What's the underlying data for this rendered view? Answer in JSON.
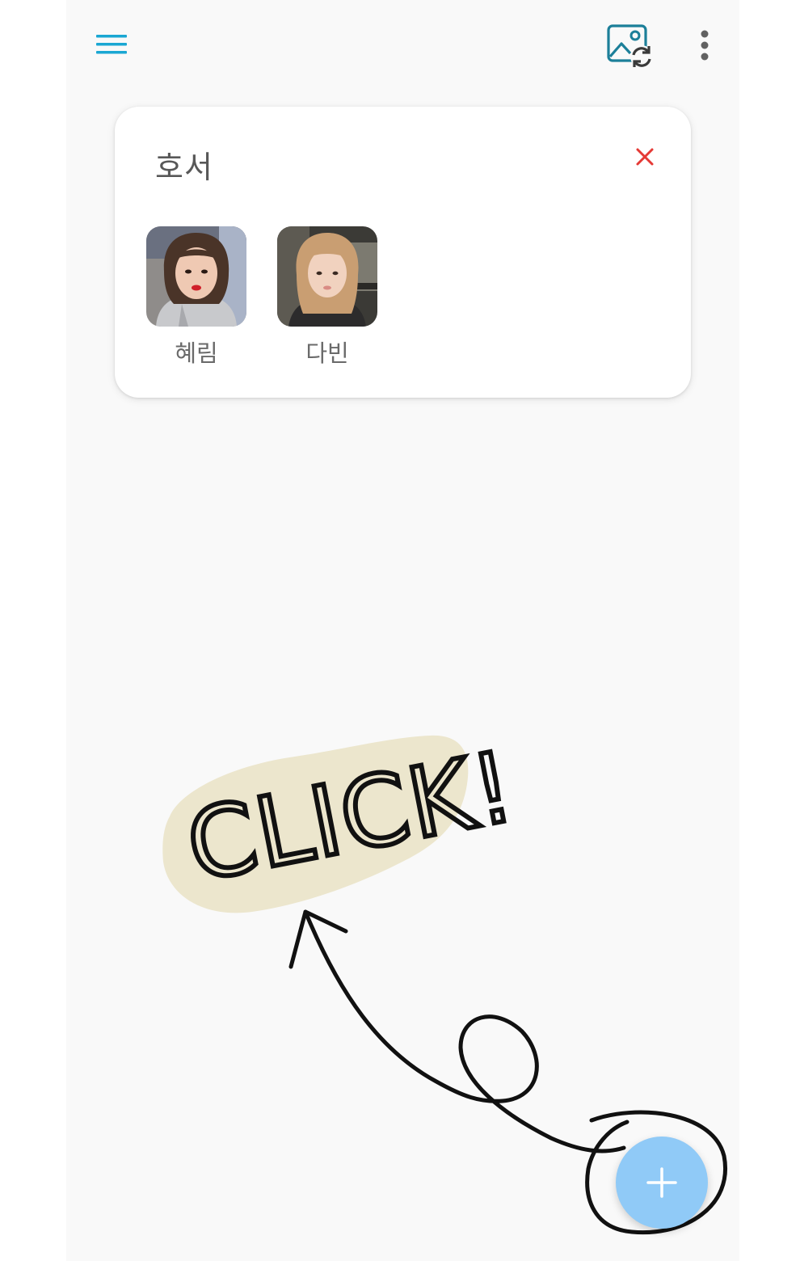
{
  "toolbar": {
    "menu_icon": "hamburger-menu-icon",
    "gallery_icon": "image-sync-icon",
    "more_icon": "vertical-ellipsis-icon",
    "accent_color": "#1aa7d3"
  },
  "group_card": {
    "title": "호서",
    "close_icon": "close-x-icon",
    "close_color": "#e53935",
    "members": [
      {
        "name": "혜림",
        "avatar": "photo-of-person"
      },
      {
        "name": "다빈",
        "avatar": "photo-of-person"
      }
    ]
  },
  "annotation": {
    "text": "CLICK!",
    "highlight_color": "#ece6cd"
  },
  "fab": {
    "icon": "plus-icon",
    "color": "#90caf7"
  }
}
